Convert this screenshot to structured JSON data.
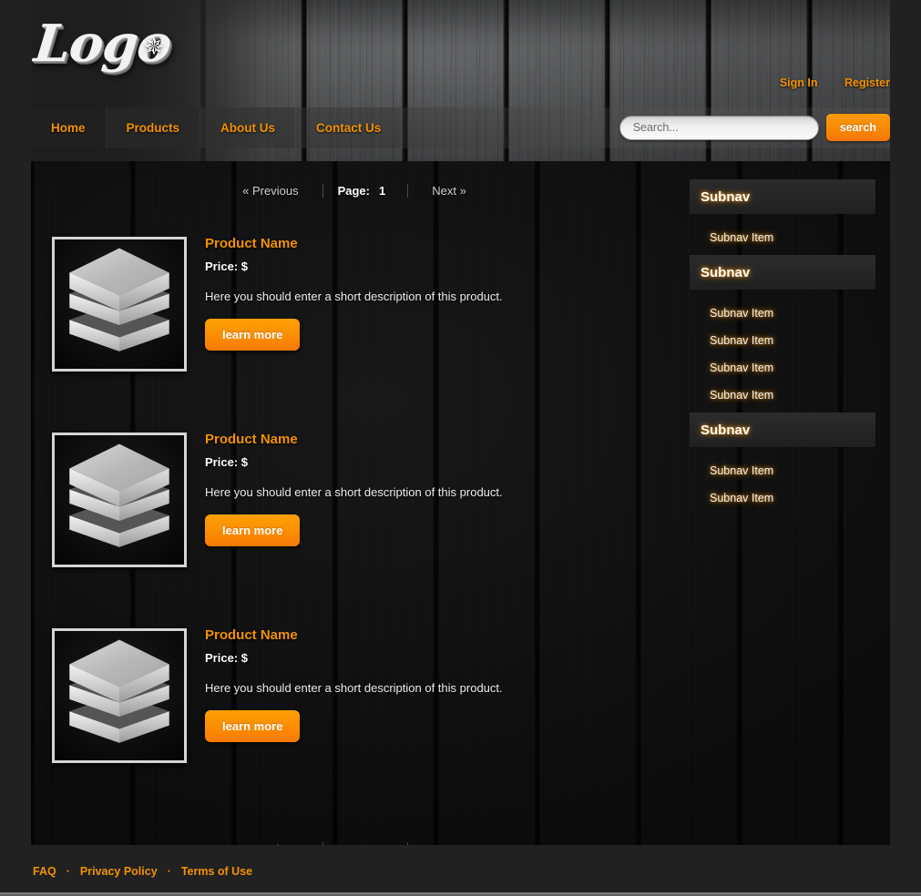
{
  "site": {
    "logo_text": "Logo",
    "logo_star_icon": "star-icon"
  },
  "header": {
    "account_links": [
      {
        "label": "Sign In",
        "name": "sign-in-link"
      },
      {
        "label": "Register",
        "name": "register-link"
      }
    ],
    "nav_items": [
      {
        "label": "Home",
        "name": "nav-item-home"
      },
      {
        "label": "Products",
        "name": "nav-item-products"
      },
      {
        "label": "About Us",
        "name": "nav-item-about-us"
      },
      {
        "label": "Contact Us",
        "name": "nav-item-contact-us"
      }
    ],
    "search": {
      "placeholder": "Search...",
      "value": "",
      "button_label": "search"
    }
  },
  "pagination": {
    "previous_label": "« Previous",
    "page_label": "Page:",
    "current_page": "1",
    "next_label": "Next »"
  },
  "products": [
    {
      "title": "Product Name",
      "price": "Price: $",
      "description": "Here you should enter a short description of this product.",
      "button_label": "learn more",
      "image_icon": "stacked-layers-icon"
    },
    {
      "title": "Product Name",
      "price": "Price: $",
      "description": "Here you should enter a short description of this product.",
      "button_label": "learn more",
      "image_icon": "stacked-layers-icon"
    },
    {
      "title": "Product Name",
      "price": "Price: $",
      "description": "Here you should enter a short description of this product.",
      "button_label": "learn more",
      "image_icon": "stacked-layers-icon"
    }
  ],
  "sidebar": {
    "groups": [
      {
        "heading": "Subnav",
        "items": [
          {
            "label": "Subnav Item"
          }
        ]
      },
      {
        "heading": "Subnav",
        "items": [
          {
            "label": "Subnav Item"
          },
          {
            "label": "Subnav Item"
          },
          {
            "label": "Subnav Item"
          },
          {
            "label": "Subnav Item"
          }
        ]
      },
      {
        "heading": "Subnav",
        "items": [
          {
            "label": "Subnav Item"
          },
          {
            "label": "Subnav Item"
          }
        ]
      }
    ]
  },
  "footer": {
    "links": [
      {
        "label": "FAQ"
      },
      {
        "label": "Privacy Policy"
      },
      {
        "label": "Terms of Use"
      }
    ],
    "separator": "·"
  },
  "colors": {
    "accent_orange": "#f39200",
    "button_orange": "#fb9103",
    "page_background": "#212121",
    "content_background": "#0e0e0e",
    "text_white": "#ffffff",
    "subnav_glow": "#ff961e"
  }
}
